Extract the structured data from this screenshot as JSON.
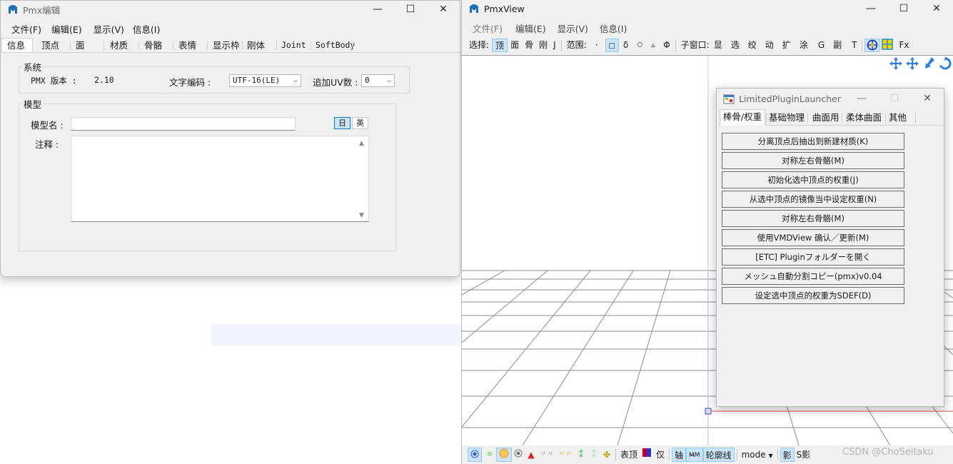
{
  "left_window": {
    "title": "Pmx编辑",
    "menu": [
      "文件(F)",
      "编辑(E)",
      "显示(V)",
      "信息(I)"
    ],
    "tabs": [
      "信息",
      "顶点",
      "面",
      "材质",
      "骨骼",
      "表情",
      "显示枠",
      "刚体",
      "Joint",
      "SoftBody"
    ],
    "system": {
      "legend": "系统",
      "version_label": "PMX 版本 :",
      "version_value": "2.10",
      "encoding_label": "文字编码 :",
      "encoding_value": "UTF-16(LE)",
      "uv_label": "追加UV数 :",
      "uv_value": "0"
    },
    "model": {
      "legend": "模型",
      "name_label": "模型名 :",
      "name_value": "",
      "lang_jp": "日",
      "lang_en": "英",
      "comment_label": "注释 :",
      "comment_value": ""
    }
  },
  "right_window": {
    "title": "PmxView",
    "menu": [
      "文件(F)",
      "编辑(E)",
      "显示(V)",
      "信息(I)"
    ],
    "toolbar": {
      "select_label": "选择:",
      "select_items": [
        "顶",
        "面",
        "骨",
        "刚",
        "J"
      ],
      "range_label": "范围:",
      "range_items": [
        "·",
        "□",
        "δ",
        "○",
        "▵",
        "Φ"
      ],
      "subwin_label": "子窗口:",
      "subwin_items": [
        "显",
        "选",
        "绞",
        "动",
        "扩",
        "涂",
        "G",
        "副",
        "T"
      ],
      "fx_label": "Fx"
    },
    "bottombar": {
      "table_vertex": "表顶",
      "only": "仅",
      "axis": "轴",
      "outline": "轮廓线",
      "mode": "mode",
      "shadow": "影",
      "s_shadow": "S影"
    }
  },
  "plugin_window": {
    "title": "LimitedPluginLauncher",
    "tabs": [
      "棒骨/权重",
      "基础物理",
      "曲面用",
      "柔体曲面",
      "其他"
    ],
    "buttons": [
      "分离顶点后抽出到新建材质(K)",
      "对称左右骨骼(M)",
      "初始化选中顶点的权重(J)",
      "从选中顶点的镜像当中设定权重(N)",
      "对称左右骨骼(M)",
      "使用VMDView 确认／更新(M)",
      "[ETC] Pluginフォルダーを開く",
      "メッシュ自動分割コピー(pmx)v0.04",
      "设定选中顶点的权重为SDEF(D)"
    ]
  },
  "watermark": "CSDN @ChoSeitaku",
  "colors": {
    "selection_bg": "#cce4f7",
    "window_bg": "#f0f0f0",
    "grid_line": "#9a9a9a",
    "axis_red": "#e05050"
  }
}
